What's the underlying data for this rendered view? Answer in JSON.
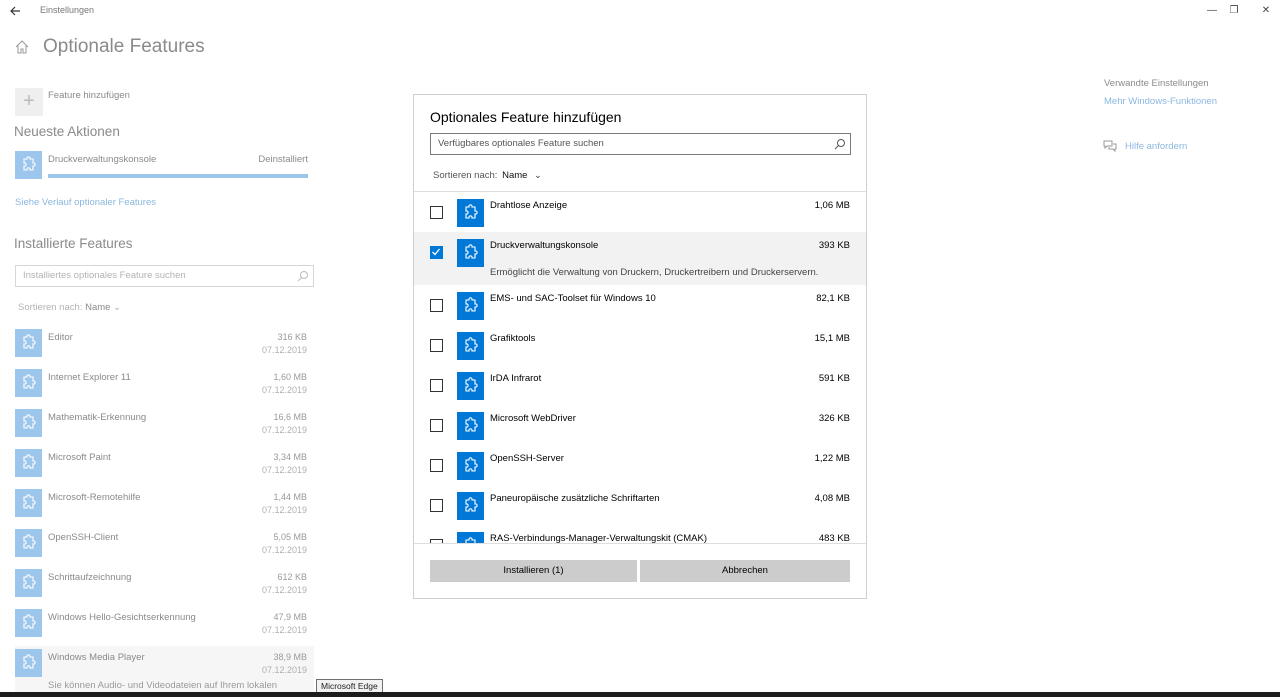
{
  "window": {
    "title": "Einstellungen",
    "back_icon": "back-arrow-icon",
    "controls": {
      "minimize": "—",
      "maximize": "❐",
      "close": "✕"
    }
  },
  "page": {
    "title": "Optionale Features",
    "add_feature_label": "Feature hinzufügen"
  },
  "recent": {
    "heading": "Neueste Aktionen",
    "item": {
      "name": "Druckverwaltungskonsole",
      "status": "Deinstalliert",
      "progress": 1.0
    },
    "history_link": "Siehe Verlauf optionaler Features"
  },
  "installed": {
    "heading": "Installierte Features",
    "search_placeholder": "Installiertes optionales Feature suchen",
    "sort_label": "Sortieren nach:",
    "sort_value": "Name",
    "items": [
      {
        "name": "Editor",
        "size": "316 KB",
        "date": "07.12.2019"
      },
      {
        "name": "Internet Explorer 11",
        "size": "1,60 MB",
        "date": "07.12.2019"
      },
      {
        "name": "Mathematik-Erkennung",
        "size": "16,6 MB",
        "date": "07.12.2019"
      },
      {
        "name": "Microsoft Paint",
        "size": "3,34 MB",
        "date": "07.12.2019"
      },
      {
        "name": "Microsoft-Remotehilfe",
        "size": "1,44 MB",
        "date": "07.12.2019"
      },
      {
        "name": "OpenSSH-Client",
        "size": "5,05 MB",
        "date": "07.12.2019"
      },
      {
        "name": "Schrittaufzeichnung",
        "size": "612 KB",
        "date": "07.12.2019"
      },
      {
        "name": "Windows Hello-Gesichtserkennung",
        "size": "47,9 MB",
        "date": "07.12.2019"
      },
      {
        "name": "Windows Media Player",
        "size": "38,9 MB",
        "date": "07.12.2019",
        "description": "Sie können Audio- und Videodateien auf Ihrem lokalen"
      }
    ]
  },
  "related": {
    "heading": "Verwandte Einstellungen",
    "link": "Mehr Windows-Funktionen",
    "help": "Hilfe anfordern"
  },
  "tooltip": "Microsoft Edge",
  "dialog": {
    "title": "Optionales Feature hinzufügen",
    "search_placeholder": "Verfügbares optionales Feature suchen",
    "sort_label": "Sortieren nach:",
    "sort_value": "Name",
    "features": [
      {
        "name": "Drahtlose Anzeige",
        "size": "1,06 MB",
        "checked": false
      },
      {
        "name": "Druckverwaltungskonsole",
        "size": "393 KB",
        "checked": true,
        "description": "Ermöglicht die Verwaltung von Druckern, Druckertreibern und Druckerservern."
      },
      {
        "name": "EMS- und SAC-Toolset für Windows 10",
        "size": "82,1 KB",
        "checked": false
      },
      {
        "name": "Grafiktools",
        "size": "15,1 MB",
        "checked": false
      },
      {
        "name": "IrDA Infrarot",
        "size": "591 KB",
        "checked": false
      },
      {
        "name": "Microsoft WebDriver",
        "size": "326 KB",
        "checked": false
      },
      {
        "name": "OpenSSH-Server",
        "size": "1,22 MB",
        "checked": false
      },
      {
        "name": "Paneuropäische zusätzliche Schriftarten",
        "size": "4,08 MB",
        "checked": false
      },
      {
        "name": "RAS-Verbindungs-Manager-Verwaltungskit (CMAK)",
        "size": "483 KB",
        "checked": false
      }
    ],
    "install_label": "Installieren (1)",
    "cancel_label": "Abbrechen"
  },
  "colors": {
    "accent": "#0078d7",
    "icon_dimmed": "#9cc6ec",
    "link_dimmed": "#8bb7e0",
    "button": "#cccccc"
  }
}
